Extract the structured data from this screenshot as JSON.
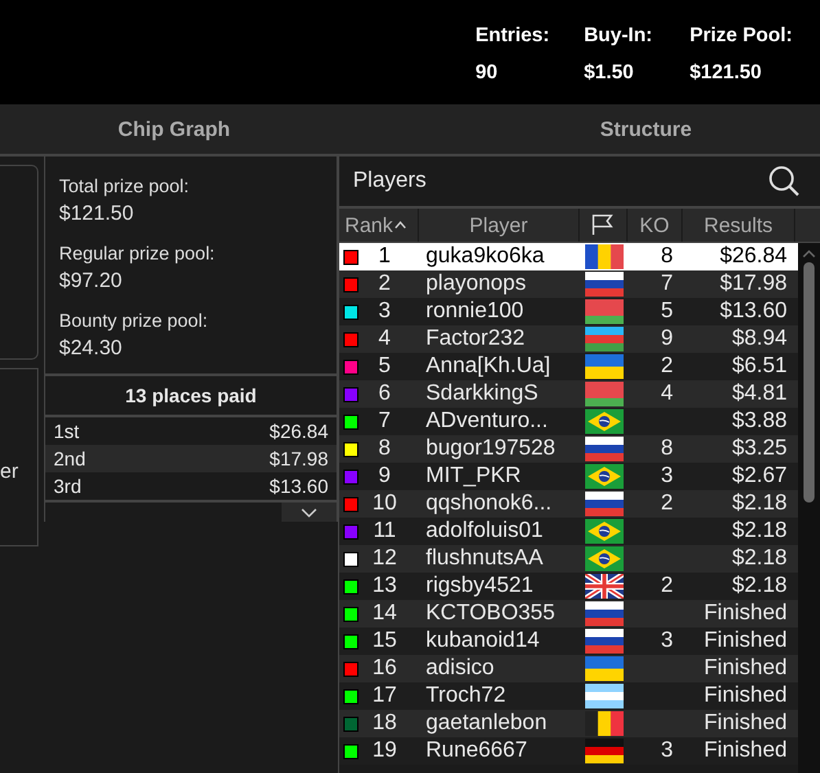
{
  "header": {
    "stats": [
      {
        "label": "Entries:",
        "value": "90"
      },
      {
        "label": "Buy-In:",
        "value": "$1.50"
      },
      {
        "label": "Prize Pool:",
        "value": "$121.50"
      }
    ]
  },
  "tabs": [
    {
      "label": "Chip Graph",
      "selected": false
    },
    {
      "label": "Structure",
      "selected": false
    }
  ],
  "left_panel": {
    "text": "er"
  },
  "prize_info": {
    "items": [
      {
        "label": "Total prize pool:",
        "value": "$121.50"
      },
      {
        "label": "Regular prize pool:",
        "value": "$97.20"
      },
      {
        "label": "Bounty prize pool:",
        "value": "$24.30"
      }
    ],
    "places_paid": "13 places paid",
    "places": [
      {
        "place": "1st",
        "amount": "$26.84"
      },
      {
        "place": "2nd",
        "amount": "$17.98"
      },
      {
        "place": "3rd",
        "amount": "$13.60"
      }
    ]
  },
  "players": {
    "title": "Players",
    "columns": [
      "Rank",
      "Player",
      "KO",
      "Results"
    ],
    "rows": [
      {
        "color": "#ff0000",
        "rank": "1",
        "name": "guka9ko6ka",
        "flag": {
          "kind": "md"
        },
        "ko": "8",
        "result": "$26.84",
        "selected": true
      },
      {
        "color": "#ff0000",
        "rank": "2",
        "name": "playonops",
        "flag": {
          "kind": "ru"
        },
        "ko": "7",
        "result": "$17.98",
        "selected": false
      },
      {
        "color": "#00e5e5",
        "rank": "3",
        "name": "ronnie100",
        "flag": {
          "kind": "by"
        },
        "ko": "5",
        "result": "$13.60",
        "selected": false
      },
      {
        "color": "#ff0000",
        "rank": "4",
        "name": "Factor232",
        "flag": {
          "kind": "az"
        },
        "ko": "9",
        "result": "$8.94",
        "selected": false
      },
      {
        "color": "#ff0088",
        "rank": "5",
        "name": "Anna[Kh.Ua]",
        "flag": {
          "kind": "ua"
        },
        "ko": "2",
        "result": "$6.51",
        "selected": false
      },
      {
        "color": "#8800ff",
        "rank": "6",
        "name": "SdarkkingS",
        "flag": {
          "kind": "by"
        },
        "ko": "4",
        "result": "$4.81",
        "selected": false
      },
      {
        "color": "#00ff00",
        "rank": "7",
        "name": "ADventuro...",
        "flag": {
          "kind": "br"
        },
        "result": "$3.88",
        "selected": false
      },
      {
        "color": "#ffff00",
        "rank": "8",
        "name": "bugor197528",
        "flag": {
          "kind": "ru"
        },
        "ko": "8",
        "result": "$3.25",
        "selected": false
      },
      {
        "color": "#8800ff",
        "rank": "9",
        "name": "MIT_PKR",
        "flag": {
          "kind": "br"
        },
        "ko": "3",
        "result": "$2.67",
        "selected": false
      },
      {
        "color": "#ff0000",
        "rank": "10",
        "name": "qqshonok6...",
        "flag": {
          "kind": "ru"
        },
        "ko": "2",
        "result": "$2.18",
        "selected": false
      },
      {
        "color": "#8800ff",
        "rank": "11",
        "name": "adolfoluis01",
        "flag": {
          "kind": "br"
        },
        "result": "$2.18",
        "selected": false
      },
      {
        "color": "#ffffff",
        "rank": "12",
        "name": "flushnutsAA",
        "flag": {
          "kind": "br"
        },
        "result": "$2.18",
        "selected": false
      },
      {
        "color": "#00ff00",
        "rank": "13",
        "name": "rigsby4521",
        "flag": {
          "kind": "gb"
        },
        "ko": "2",
        "result": "$2.18",
        "selected": false
      },
      {
        "color": "#00ff00",
        "rank": "14",
        "name": "KCTOBO355",
        "flag": {
          "kind": "ru"
        },
        "result": "Finished",
        "selected": false
      },
      {
        "color": "#00ff00",
        "rank": "15",
        "name": "kubanoid14",
        "flag": {
          "kind": "ru"
        },
        "ko": "3",
        "result": "Finished",
        "selected": false
      },
      {
        "color": "#ff0000",
        "rank": "16",
        "name": "adisico",
        "flag": {
          "kind": "ua"
        },
        "result": "Finished",
        "selected": false
      },
      {
        "color": "#00ff00",
        "rank": "17",
        "name": "Troch72",
        "flag": {
          "kind": "ar"
        },
        "result": "Finished",
        "selected": false
      },
      {
        "color": "#006633",
        "rank": "18",
        "name": "gaetanlebon",
        "flag": {
          "kind": "be"
        },
        "result": "Finished",
        "selected": false
      },
      {
        "color": "#00ff00",
        "rank": "19",
        "name": "Rune6667",
        "flag": {
          "kind": "de"
        },
        "ko": "3",
        "result": "Finished",
        "selected": false
      }
    ]
  }
}
